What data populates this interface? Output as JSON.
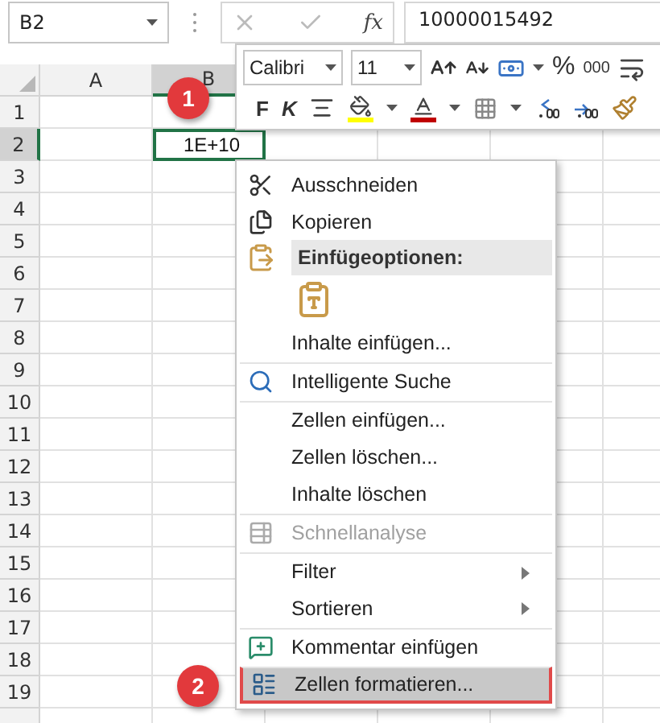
{
  "name_box": {
    "value": "B2"
  },
  "formula_bar": {
    "fx_label": "fx",
    "value": "10000015492"
  },
  "column_headers": [
    {
      "label": "A",
      "selected": false
    },
    {
      "label": "B",
      "selected": true
    }
  ],
  "rows": [
    {
      "label": "1",
      "selected": false
    },
    {
      "label": "2",
      "selected": true,
      "b_value": "1E+10"
    },
    {
      "label": "3",
      "selected": false
    },
    {
      "label": "4",
      "selected": false
    },
    {
      "label": "5",
      "selected": false
    },
    {
      "label": "6",
      "selected": false
    },
    {
      "label": "7",
      "selected": false
    },
    {
      "label": "8",
      "selected": false
    },
    {
      "label": "9",
      "selected": false
    },
    {
      "label": "10",
      "selected": false
    },
    {
      "label": "11",
      "selected": false
    },
    {
      "label": "12",
      "selected": false
    },
    {
      "label": "13",
      "selected": false
    },
    {
      "label": "14",
      "selected": false
    },
    {
      "label": "15",
      "selected": false
    },
    {
      "label": "16",
      "selected": false
    },
    {
      "label": "17",
      "selected": false
    },
    {
      "label": "18",
      "selected": false
    },
    {
      "label": "19",
      "selected": false
    }
  ],
  "mini_toolbar": {
    "font": "Calibri",
    "size": "11",
    "percent": "%",
    "thousands": "000",
    "bold": "F",
    "italic": "K"
  },
  "context_menu": [
    {
      "kind": "item",
      "label": "Ausschneiden",
      "disabled": false,
      "submenu": false,
      "highlighted": false,
      "separator_before": false
    },
    {
      "kind": "item",
      "label": "Kopieren",
      "disabled": false,
      "submenu": false,
      "highlighted": false,
      "separator_before": false
    },
    {
      "kind": "header",
      "label": "Einfügeoptionen:"
    },
    {
      "kind": "paste_option"
    },
    {
      "kind": "item",
      "label": "Inhalte einfügen...",
      "disabled": false,
      "submenu": false,
      "highlighted": false,
      "separator_before": false
    },
    {
      "kind": "item",
      "label": "Intelligente Suche",
      "disabled": false,
      "submenu": false,
      "highlighted": false,
      "separator_before": true
    },
    {
      "kind": "item",
      "label": "Zellen einfügen...",
      "disabled": false,
      "submenu": false,
      "highlighted": false,
      "separator_before": true
    },
    {
      "kind": "item",
      "label": "Zellen löschen...",
      "disabled": false,
      "submenu": false,
      "highlighted": false,
      "separator_before": false
    },
    {
      "kind": "item",
      "label": "Inhalte löschen",
      "disabled": false,
      "submenu": false,
      "highlighted": false,
      "separator_before": false
    },
    {
      "kind": "item",
      "label": "Schnellanalyse",
      "disabled": true,
      "submenu": false,
      "highlighted": false,
      "separator_before": true
    },
    {
      "kind": "item",
      "label": "Filter",
      "disabled": false,
      "submenu": true,
      "highlighted": false,
      "separator_before": true
    },
    {
      "kind": "item",
      "label": "Sortieren",
      "disabled": false,
      "submenu": true,
      "highlighted": false,
      "separator_before": false
    },
    {
      "kind": "item",
      "label": "Kommentar einfügen",
      "disabled": false,
      "submenu": false,
      "highlighted": false,
      "separator_before": true
    },
    {
      "kind": "item",
      "label": "Zellen formatieren...",
      "disabled": false,
      "submenu": false,
      "highlighted": true,
      "separator_before": true
    }
  ],
  "callouts": [
    {
      "label": "1"
    },
    {
      "label": "2"
    }
  ]
}
